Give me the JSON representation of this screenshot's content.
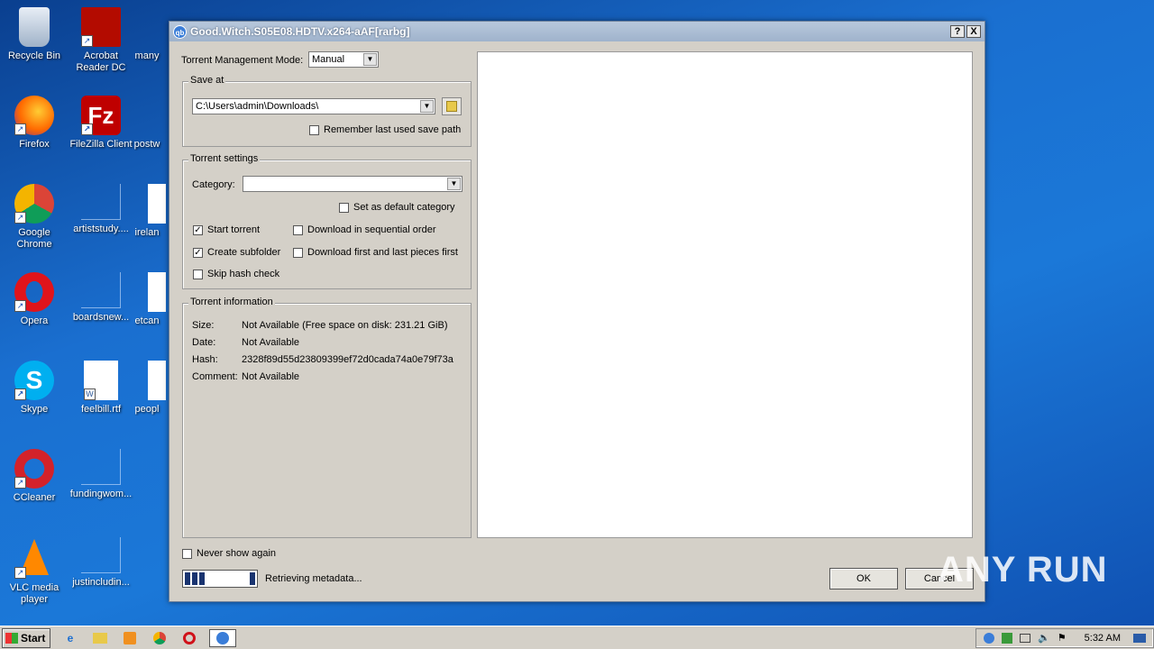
{
  "desktop": {
    "icons": [
      {
        "label": "Recycle Bin",
        "icon": "recycle-bin-icon"
      },
      {
        "label": "Acrobat Reader DC",
        "icon": "acrobat-icon"
      },
      {
        "label": "many",
        "icon": "document-icon"
      },
      {
        "label": "Firefox",
        "icon": "firefox-icon"
      },
      {
        "label": "FileZilla Client",
        "icon": "filezilla-icon"
      },
      {
        "label": "postw",
        "icon": "document-icon"
      },
      {
        "label": "Google Chrome",
        "icon": "chrome-icon"
      },
      {
        "label": "artiststudy....",
        "icon": "blank-document-icon"
      },
      {
        "label": "irelan",
        "icon": "word-icon"
      },
      {
        "label": "Opera",
        "icon": "opera-icon"
      },
      {
        "label": "boardsnew...",
        "icon": "blank-document-icon"
      },
      {
        "label": "etcan",
        "icon": "word-icon"
      },
      {
        "label": "Skype",
        "icon": "skype-icon"
      },
      {
        "label": "feelbill.rtf",
        "icon": "word-icon"
      },
      {
        "label": "peopl",
        "icon": "word-icon"
      },
      {
        "label": "CCleaner",
        "icon": "ccleaner-icon"
      },
      {
        "label": "fundingwom...",
        "icon": "blank-document-icon"
      },
      {
        "label": "VLC media player",
        "icon": "vlc-icon"
      },
      {
        "label": "justincludin...",
        "icon": "blank-document-icon"
      }
    ]
  },
  "dialog": {
    "title": "Good.Witch.S05E08.HDTV.x264-aAF[rarbg]",
    "help_btn": "?",
    "close_btn": "X",
    "mgmt_label": "Torrent Management Mode:",
    "mgmt_value": "Manual",
    "save_at": {
      "title": "Save at",
      "path": "C:\\Users\\admin\\Downloads\\",
      "remember_label": "Remember last used save path"
    },
    "settings": {
      "title": "Torrent settings",
      "category_label": "Category:",
      "category_value": "",
      "default_category_label": "Set as default category",
      "start_torrent": "Start torrent",
      "sequential": "Download in sequential order",
      "create_subfolder": "Create subfolder",
      "first_last": "Download first and last pieces first",
      "skip_hash": "Skip hash check"
    },
    "info": {
      "title": "Torrent information",
      "size_label": "Size:",
      "size_value": "Not Available (Free space on disk: 231.21 GiB)",
      "date_label": "Date:",
      "date_value": "Not Available",
      "hash_label": "Hash:",
      "hash_value": "2328f89d55d23809399ef72d0cada74a0e79f73a",
      "comment_label": "Comment:",
      "comment_value": "Not Available"
    },
    "never_show": "Never show again",
    "status": "Retrieving metadata...",
    "ok": "OK",
    "cancel": "Cancel"
  },
  "taskbar": {
    "start": "Start",
    "time": "5:32 AM"
  },
  "watermark": "ANY RUN"
}
